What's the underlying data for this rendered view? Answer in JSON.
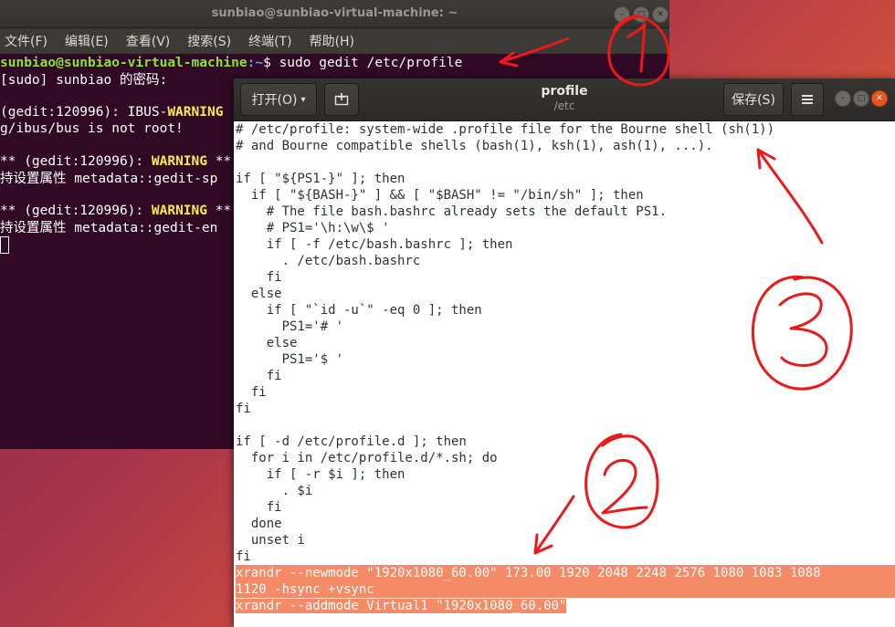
{
  "terminal": {
    "title": "sunbiao@sunbiao-virtual-machine: ~",
    "menu": [
      "文件(F)",
      "编辑(E)",
      "查看(V)",
      "搜索(S)",
      "终端(T)",
      "帮助(H)"
    ],
    "prompt_user": "sunbiao@sunbiao-virtual-machine",
    "prompt_path": ":~",
    "prompt_symbol": "$ ",
    "command": "sudo gedit /etc/profile",
    "sudo_prompt": "[sudo] sunbiao 的密码:",
    "line_ibus_a": "(gedit:120996): IBUS-",
    "line_ibus_warn": "WARNING",
    "line_ibus_b": "g/ibus/bus is not root!",
    "line_w1_a": "** (gedit:120996): ",
    "line_w1_warn": "WARNING",
    "line_w1_b": " **",
    "line_w1_c": "持设置属性 metadata::gedit-sp",
    "line_w2_a": "** (gedit:120996): ",
    "line_w2_warn": "WARNING",
    "line_w2_b": " **",
    "line_w2_c": "持设置属性 metadata::gedit-en"
  },
  "gedit": {
    "open_label": "打开(O)",
    "title": "profile",
    "subtitle": "/etc",
    "save_label": "保存(S)",
    "lines": [
      "# /etc/profile: system-wide .profile file for the Bourne shell (sh(1))",
      "# and Bourne compatible shells (bash(1), ksh(1), ash(1), ...).",
      "",
      "if [ \"${PS1-}\" ]; then",
      "  if [ \"${BASH-}\" ] && [ \"$BASH\" != \"/bin/sh\" ]; then",
      "    # The file bash.bashrc already sets the default PS1.",
      "    # PS1='\\h:\\w\\$ '",
      "    if [ -f /etc/bash.bashrc ]; then",
      "      . /etc/bash.bashrc",
      "    fi",
      "  else",
      "    if [ \"`id -u`\" -eq 0 ]; then",
      "      PS1='# '",
      "    else",
      "      PS1='$ '",
      "    fi",
      "  fi",
      "fi",
      "",
      "if [ -d /etc/profile.d ]; then",
      "  for i in /etc/profile.d/*.sh; do",
      "    if [ -r $i ]; then",
      "      . $i",
      "    fi",
      "  done",
      "  unset i",
      "fi"
    ],
    "highlighted_lines": [
      "xrandr --newmode \"1920x1080_60.00\" 173.00 1920 2048 2248 2576 1080 1083 1088",
      "1120 -hsync +vsync"
    ],
    "last_line": "xrandr --addmode Virtual1 \"1920x1080_60.00\""
  }
}
